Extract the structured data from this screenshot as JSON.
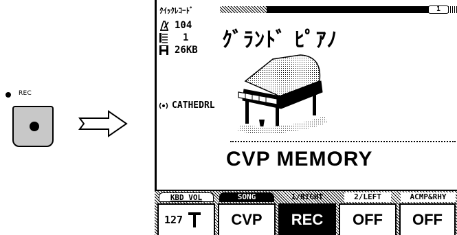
{
  "panel": {
    "rec_label": "REC"
  },
  "lcd": {
    "title": "ｸｲｯｸﾚｺｰﾄﾞ",
    "page_indicator": "1",
    "tempo": "104",
    "measure": "1",
    "size": "26KB",
    "song_name": "ｸﾞﾗﾝﾄﾞ ﾋﾟｱﾉ",
    "reverb": "CATHEDRL",
    "memory": "CVP MEMORY"
  },
  "tabs": [
    {
      "label": "KBD VOL",
      "value": "127"
    },
    {
      "label": "SONG",
      "value": "CVP"
    },
    {
      "label": "1/RIGHT",
      "value": "REC"
    },
    {
      "label": "2/LEFT",
      "value": "OFF"
    },
    {
      "label": "ACMP&RHY",
      "value": "OFF"
    }
  ],
  "icons": {
    "metronome": "metronome-icon",
    "measure": "measure-icon",
    "disk": "disk-icon",
    "reverb": "reverb-icon",
    "fader": "fader-icon"
  }
}
